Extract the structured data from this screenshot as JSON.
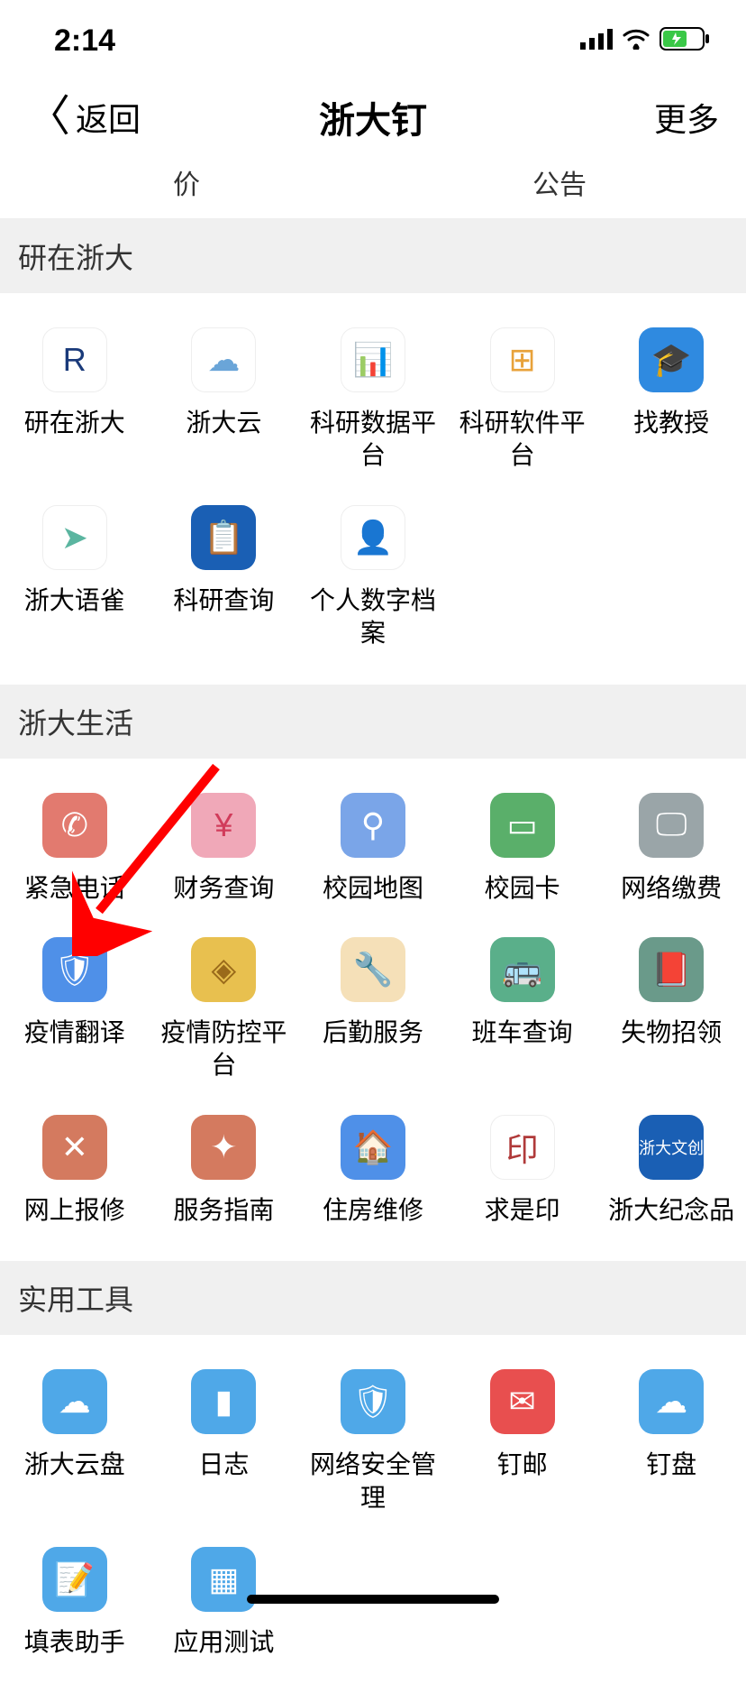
{
  "status": {
    "time": "2:14"
  },
  "nav": {
    "back": "返回",
    "title": "浙大钉",
    "more": "更多"
  },
  "tabs": {
    "left": "价",
    "right": "公告"
  },
  "sections": [
    {
      "title": "研在浙大",
      "items": [
        {
          "label": "研在浙大",
          "icon": "R",
          "bg": "#ffffff",
          "fg": "#1a3a7a",
          "name": "research-zju-icon"
        },
        {
          "label": "浙大云",
          "icon": "☁",
          "bg": "#ffffff",
          "fg": "#6aa5d8",
          "name": "zju-cloud-icon"
        },
        {
          "label": "科研数据平台",
          "icon": "📊",
          "bg": "#ffffff",
          "fg": "#e8a23a",
          "name": "research-data-icon"
        },
        {
          "label": "科研软件平台",
          "icon": "⊞",
          "bg": "#ffffff",
          "fg": "#e8a23a",
          "name": "research-software-icon"
        },
        {
          "label": "找教授",
          "icon": "🎓",
          "bg": "#2f8ae0",
          "fg": "#ffffff",
          "name": "find-professor-icon"
        },
        {
          "label": "浙大语雀",
          "icon": "➤",
          "bg": "#ffffff",
          "fg": "#5bb5a0",
          "name": "yuque-icon"
        },
        {
          "label": "科研查询",
          "icon": "📋",
          "bg": "#1a5fb4",
          "fg": "#ffffff",
          "name": "research-query-icon"
        },
        {
          "label": "个人数字档案",
          "icon": "👤",
          "bg": "#ffffff",
          "fg": "#6fb0c9",
          "name": "digital-archive-icon"
        }
      ]
    },
    {
      "title": "浙大生活",
      "items": [
        {
          "label": "紧急电话",
          "icon": "✆",
          "bg": "#e27a6f",
          "fg": "#ffffff",
          "name": "emergency-phone-icon"
        },
        {
          "label": "财务查询",
          "icon": "¥",
          "bg": "#f0a8b8",
          "fg": "#d13b5a",
          "name": "finance-query-icon"
        },
        {
          "label": "校园地图",
          "icon": "⚲",
          "bg": "#7aa5e8",
          "fg": "#ffffff",
          "name": "campus-map-icon"
        },
        {
          "label": "校园卡",
          "icon": "▭",
          "bg": "#5aaf6a",
          "fg": "#ffffff",
          "name": "campus-card-icon"
        },
        {
          "label": "网络缴费",
          "icon": "🖵",
          "bg": "#9aa5a8",
          "fg": "#ffffff",
          "name": "network-fee-icon"
        },
        {
          "label": "疫情翻译",
          "icon": "🛡",
          "bg": "#4f90e8",
          "fg": "#ffffff",
          "name": "epidemic-translate-icon"
        },
        {
          "label": "疫情防控平台",
          "icon": "◈",
          "bg": "#e8c04f",
          "fg": "#9a6a1a",
          "name": "epidemic-control-icon"
        },
        {
          "label": "后勤服务",
          "icon": "🔧",
          "bg": "#f5e0b8",
          "fg": "#c88a2a",
          "name": "logistics-icon"
        },
        {
          "label": "班车查询",
          "icon": "🚌",
          "bg": "#5aaf8a",
          "fg": "#ffffff",
          "name": "shuttle-query-icon"
        },
        {
          "label": "失物招领",
          "icon": "📕",
          "bg": "#6a9a8a",
          "fg": "#ffffff",
          "name": "lost-found-icon"
        },
        {
          "label": "网上报修",
          "icon": "✕",
          "bg": "#d47a5f",
          "fg": "#ffffff",
          "name": "online-repair-icon"
        },
        {
          "label": "服务指南",
          "icon": "✦",
          "bg": "#d47a5f",
          "fg": "#ffffff",
          "name": "service-guide-icon"
        },
        {
          "label": "住房维修",
          "icon": "🏠",
          "bg": "#4f90e8",
          "fg": "#ffffff",
          "name": "housing-repair-icon"
        },
        {
          "label": "求是印",
          "icon": "印",
          "bg": "#ffffff",
          "fg": "#b03a3a",
          "name": "qiushi-seal-icon"
        },
        {
          "label": "浙大纪念品",
          "icon": "浙大文创",
          "bg": "#1a5fb4",
          "fg": "#ffffff",
          "name": "souvenir-icon"
        }
      ]
    },
    {
      "title": "实用工具",
      "items": [
        {
          "label": "浙大云盘",
          "icon": "☁",
          "bg": "#4fa8e8",
          "fg": "#ffffff",
          "name": "cloud-disk-icon"
        },
        {
          "label": "日志",
          "icon": "▮",
          "bg": "#4fa8e8",
          "fg": "#ffffff",
          "name": "journal-icon"
        },
        {
          "label": "网络安全管理",
          "icon": "🛡",
          "bg": "#4fa8e8",
          "fg": "#ffffff",
          "name": "network-security-icon"
        },
        {
          "label": "钉邮",
          "icon": "✉",
          "bg": "#e84f4f",
          "fg": "#ffffff",
          "name": "ding-mail-icon"
        },
        {
          "label": "钉盘",
          "icon": "☁",
          "bg": "#4fa8e8",
          "fg": "#ffffff",
          "name": "ding-disk-icon"
        },
        {
          "label": "填表助手",
          "icon": "📝",
          "bg": "#4fa8e8",
          "fg": "#ffffff",
          "name": "form-assistant-icon"
        },
        {
          "label": "应用测试",
          "icon": "▦",
          "bg": "#4fa8e8",
          "fg": "#ffffff",
          "name": "app-test-icon"
        }
      ]
    }
  ]
}
